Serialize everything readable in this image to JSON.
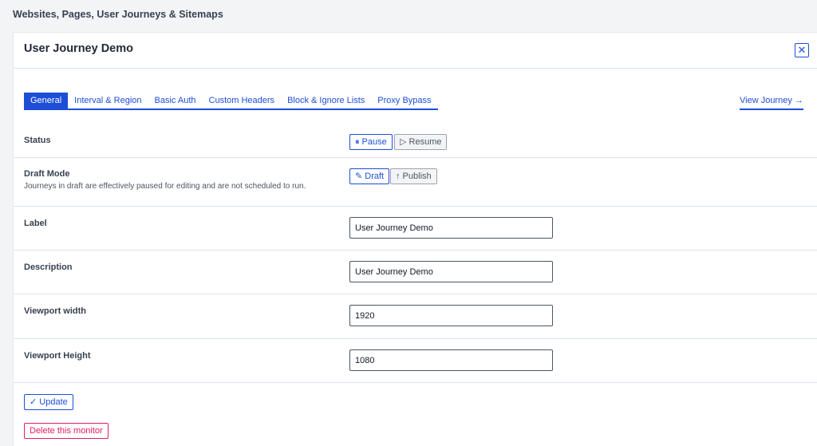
{
  "breadcrumb": "Websites, Pages, User Journeys & Sitemaps",
  "panel": {
    "title": "User Journey Demo",
    "close_label": "✕"
  },
  "tabs": [
    {
      "label": "General",
      "active": true
    },
    {
      "label": "Interval & Region",
      "active": false
    },
    {
      "label": "Basic Auth",
      "active": false
    },
    {
      "label": "Custom Headers",
      "active": false
    },
    {
      "label": "Block & Ignore Lists",
      "active": false
    },
    {
      "label": "Proxy Bypass",
      "active": false
    }
  ],
  "view_journey": "View Journey →",
  "status": {
    "label": "Status",
    "pause_label": "⏸ Pause",
    "resume_label": "▷ Resume"
  },
  "draft_mode": {
    "label": "Draft Mode",
    "help": "Journeys in draft are effectively paused for editing and are not scheduled to run.",
    "draft_label": "✎ Draft",
    "publish_label": "↑ Publish"
  },
  "fields": {
    "label": {
      "label": "Label",
      "value": "User Journey Demo"
    },
    "description": {
      "label": "Description",
      "value": "User Journey Demo"
    },
    "viewport_width": {
      "label": "Viewport width",
      "value": "1920"
    },
    "viewport_height": {
      "label": "Viewport Height",
      "value": "1080"
    }
  },
  "actions": {
    "update_label": "✓ Update",
    "delete_label": "Delete this monitor"
  },
  "colors": {
    "accent": "#1d4ed8",
    "danger": "#e11d63",
    "divider": "#dbe3ee"
  }
}
